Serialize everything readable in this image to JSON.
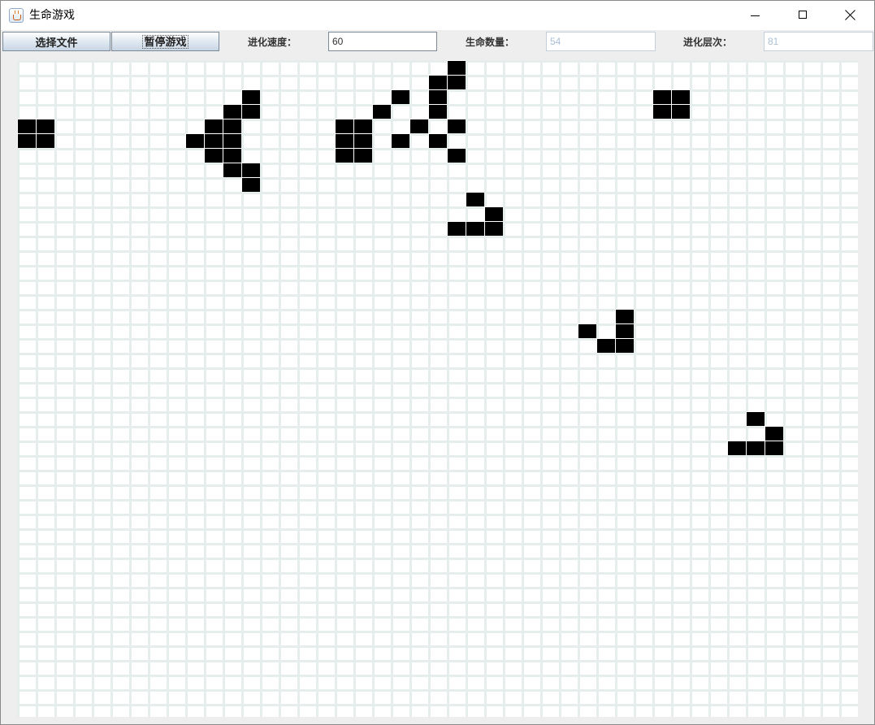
{
  "window": {
    "title": "生命游戏",
    "icon": "java-cup-icon"
  },
  "toolbar": {
    "select_file": "选择文件",
    "pause_game": "暂停游戏",
    "speed_label": "进化速度：",
    "speed_value": "60",
    "population_label": "生命数量：",
    "population_value": "54",
    "generation_label": "进化层次：",
    "generation_value": "81"
  },
  "board": {
    "columns": 45,
    "rows": 45,
    "alive_color": "#000000",
    "grid_color": "#e6eded",
    "alive_cells": [
      [
        0,
        23
      ],
      [
        1,
        22
      ],
      [
        1,
        23
      ],
      [
        2,
        12
      ],
      [
        2,
        20
      ],
      [
        2,
        22
      ],
      [
        3,
        11
      ],
      [
        3,
        12
      ],
      [
        3,
        19
      ],
      [
        3,
        22
      ],
      [
        4,
        0
      ],
      [
        4,
        1
      ],
      [
        4,
        10
      ],
      [
        4,
        11
      ],
      [
        4,
        17
      ],
      [
        4,
        18
      ],
      [
        4,
        21
      ],
      [
        4,
        23
      ],
      [
        5,
        0
      ],
      [
        5,
        1
      ],
      [
        5,
        9
      ],
      [
        5,
        10
      ],
      [
        5,
        11
      ],
      [
        5,
        17
      ],
      [
        5,
        18
      ],
      [
        5,
        20
      ],
      [
        5,
        22
      ],
      [
        6,
        10
      ],
      [
        6,
        11
      ],
      [
        6,
        17
      ],
      [
        6,
        18
      ],
      [
        6,
        23
      ],
      [
        7,
        11
      ],
      [
        7,
        12
      ],
      [
        8,
        12
      ],
      [
        9,
        24
      ],
      [
        10,
        25
      ],
      [
        11,
        23
      ],
      [
        11,
        24
      ],
      [
        11,
        25
      ],
      [
        17,
        32
      ],
      [
        18,
        30
      ],
      [
        18,
        32
      ],
      [
        19,
        31
      ],
      [
        19,
        32
      ],
      [
        24,
        39
      ],
      [
        25,
        40
      ],
      [
        26,
        38
      ],
      [
        26,
        39
      ],
      [
        26,
        40
      ],
      [
        2,
        34
      ],
      [
        2,
        35
      ],
      [
        3,
        34
      ],
      [
        3,
        35
      ]
    ]
  }
}
